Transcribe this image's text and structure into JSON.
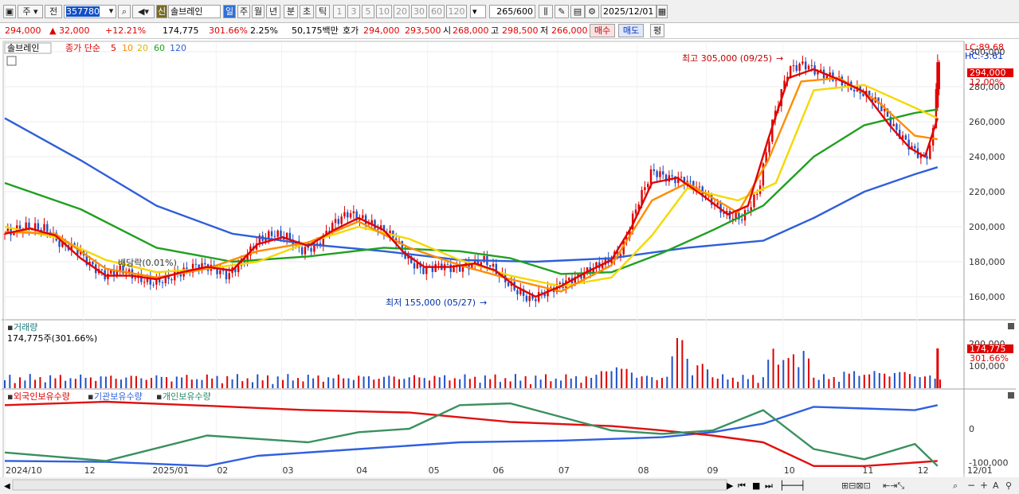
{
  "toolbar": {
    "market": "주",
    "period_ref": "전",
    "code": "357780",
    "stock_name_badge": "신",
    "stock_name": "솔브레인",
    "periods": [
      "일",
      "주",
      "월",
      "년",
      "분",
      "초",
      "틱"
    ],
    "minute_options": [
      "1",
      "3",
      "5",
      "10",
      "20",
      "30",
      "60",
      "120"
    ],
    "count": "265",
    "count_total": "/600",
    "date": "2025/12/01"
  },
  "info": {
    "price": "294,000",
    "change": "▲  32,000",
    "change_pct": "+12.21%",
    "volume": "174,775",
    "vol_ratio": "301.66%",
    "turnover": "2.25%",
    "amount": "50,175백만",
    "bid_label": "호가",
    "bid": "294,000",
    "ask": "293,500",
    "open_label": "시",
    "open": "268,000",
    "high_label": "고",
    "high": "298,500",
    "low_label": "저",
    "low": "266,000",
    "buy_button": "매수",
    "sell_button": "매도",
    "avg_button": "평"
  },
  "legend": {
    "name": "솔브레인",
    "price_label": "종가 단순",
    "ma": [
      "5",
      "10",
      "20",
      "60",
      "120"
    ]
  },
  "annotations": {
    "high": "최고 305,000 (09/25)",
    "low": "최저 155,000 (05/27)",
    "dividend": "배당락(0.01%)",
    "lc": "LC:89.68",
    "hc": "HC:-3.61",
    "price_tag": "294,000",
    "pct_tag": "12.00%",
    "vol_title": "거래량",
    "vol_value": "174,775주(301.66%)",
    "vol_tag": "174,775",
    "vol_pct_tag": "301.66%",
    "inv_titles": [
      "외국인보유수량",
      "기관보유수량",
      "개인보유수량"
    ]
  },
  "colors": {
    "up": "#e00000",
    "down": "#1f52c8",
    "ma5": "#e00000",
    "ma10": "#ff8c00",
    "ma20": "#f5d800",
    "ma60": "#20a020",
    "ma120": "#2f5fd8",
    "foreign": "#3060e0",
    "institution": "#e01010",
    "individual": "#3a9060"
  },
  "chart_data": {
    "type": "candlestick",
    "y_ticks": [
      "300,000",
      "280,000",
      "260,000",
      "240,000",
      "220,000",
      "200,000",
      "180,000",
      "160,000"
    ],
    "y_range": [
      150000,
      305000
    ],
    "vol_ticks": [
      "200,000",
      "100,000"
    ],
    "inv_ticks": [
      "0",
      "-100,000"
    ],
    "x_labels": [
      "2024/10",
      "12",
      "2025/01",
      "02",
      "03",
      "04",
      "05",
      "06",
      "07",
      "08",
      "09",
      "10",
      "11",
      "12",
      "12/01"
    ],
    "close_path": [
      [
        0,
        196000
      ],
      [
        8,
        200000
      ],
      [
        16,
        199000
      ],
      [
        22,
        190000
      ],
      [
        28,
        188000
      ],
      [
        34,
        178000
      ],
      [
        40,
        172000
      ],
      [
        46,
        176000
      ],
      [
        52,
        171000
      ],
      [
        58,
        168000
      ],
      [
        64,
        170000
      ],
      [
        70,
        174000
      ],
      [
        76,
        178000
      ],
      [
        82,
        177000
      ],
      [
        88,
        172000
      ],
      [
        94,
        180000
      ],
      [
        100,
        192000
      ],
      [
        106,
        196000
      ],
      [
        112,
        194000
      ],
      [
        118,
        186000
      ],
      [
        124,
        190000
      ],
      [
        130,
        202000
      ],
      [
        136,
        208000
      ],
      [
        142,
        204000
      ],
      [
        148,
        199000
      ],
      [
        154,
        194000
      ],
      [
        160,
        180000
      ],
      [
        166,
        175000
      ],
      [
        172,
        178000
      ],
      [
        178,
        176000
      ],
      [
        184,
        178000
      ],
      [
        190,
        181000
      ],
      [
        196,
        172000
      ],
      [
        202,
        164000
      ],
      [
        208,
        158000
      ],
      [
        214,
        163000
      ],
      [
        220,
        167000
      ],
      [
        226,
        171000
      ],
      [
        232,
        176000
      ],
      [
        238,
        180000
      ],
      [
        244,
        186000
      ],
      [
        250,
        212000
      ],
      [
        256,
        232000
      ],
      [
        262,
        228000
      ],
      [
        268,
        227000
      ],
      [
        274,
        222000
      ],
      [
        280,
        214000
      ],
      [
        286,
        206000
      ],
      [
        292,
        205000
      ],
      [
        298,
        220000
      ],
      [
        304,
        262000
      ],
      [
        310,
        290000
      ],
      [
        316,
        293000
      ],
      [
        322,
        288000
      ],
      [
        328,
        285000
      ],
      [
        334,
        280000
      ],
      [
        340,
        276000
      ],
      [
        346,
        270000
      ],
      [
        352,
        256000
      ],
      [
        358,
        246000
      ],
      [
        364,
        238000
      ],
      [
        367,
        250000
      ],
      [
        369,
        294000
      ]
    ],
    "ma5": [
      [
        0,
        196000
      ],
      [
        10,
        199000
      ],
      [
        20,
        195000
      ],
      [
        30,
        182000
      ],
      [
        40,
        172000
      ],
      [
        50,
        172000
      ],
      [
        60,
        170000
      ],
      [
        70,
        174000
      ],
      [
        80,
        177000
      ],
      [
        90,
        175000
      ],
      [
        100,
        190000
      ],
      [
        110,
        194000
      ],
      [
        120,
        189000
      ],
      [
        130,
        198000
      ],
      [
        140,
        205000
      ],
      [
        150,
        198000
      ],
      [
        158,
        185000
      ],
      [
        166,
        177000
      ],
      [
        176,
        177000
      ],
      [
        186,
        179000
      ],
      [
        194,
        175000
      ],
      [
        202,
        166000
      ],
      [
        210,
        160000
      ],
      [
        220,
        166000
      ],
      [
        230,
        174000
      ],
      [
        240,
        181000
      ],
      [
        248,
        200000
      ],
      [
        256,
        225000
      ],
      [
        266,
        228000
      ],
      [
        276,
        218000
      ],
      [
        286,
        207000
      ],
      [
        294,
        212000
      ],
      [
        302,
        250000
      ],
      [
        310,
        285000
      ],
      [
        320,
        290000
      ],
      [
        330,
        284000
      ],
      [
        340,
        277000
      ],
      [
        350,
        258000
      ],
      [
        358,
        245000
      ],
      [
        364,
        240000
      ],
      [
        369,
        262000
      ]
    ],
    "ma10": [
      [
        0,
        197000
      ],
      [
        20,
        196000
      ],
      [
        40,
        176000
      ],
      [
        60,
        171000
      ],
      [
        80,
        176000
      ],
      [
        100,
        186000
      ],
      [
        120,
        191000
      ],
      [
        140,
        203000
      ],
      [
        160,
        188000
      ],
      [
        180,
        178000
      ],
      [
        200,
        170000
      ],
      [
        220,
        163000
      ],
      [
        240,
        178000
      ],
      [
        256,
        215000
      ],
      [
        270,
        225000
      ],
      [
        290,
        208000
      ],
      [
        302,
        238000
      ],
      [
        315,
        283000
      ],
      [
        330,
        285000
      ],
      [
        345,
        272000
      ],
      [
        360,
        252000
      ],
      [
        369,
        250000
      ]
    ],
    "ma20": [
      [
        0,
        200000
      ],
      [
        20,
        194000
      ],
      [
        40,
        181000
      ],
      [
        60,
        174000
      ],
      [
        80,
        176000
      ],
      [
        100,
        180000
      ],
      [
        120,
        191000
      ],
      [
        140,
        200000
      ],
      [
        160,
        193000
      ],
      [
        180,
        181000
      ],
      [
        200,
        172000
      ],
      [
        220,
        166000
      ],
      [
        240,
        171000
      ],
      [
        256,
        195000
      ],
      [
        270,
        222000
      ],
      [
        290,
        215000
      ],
      [
        305,
        225000
      ],
      [
        320,
        278000
      ],
      [
        340,
        281000
      ],
      [
        360,
        268000
      ],
      [
        369,
        262000
      ]
    ],
    "ma60": [
      [
        0,
        225000
      ],
      [
        30,
        210000
      ],
      [
        60,
        188000
      ],
      [
        90,
        180000
      ],
      [
        120,
        183000
      ],
      [
        150,
        188000
      ],
      [
        180,
        186000
      ],
      [
        200,
        182000
      ],
      [
        220,
        173000
      ],
      [
        240,
        174000
      ],
      [
        260,
        185000
      ],
      [
        280,
        198000
      ],
      [
        300,
        212000
      ],
      [
        320,
        240000
      ],
      [
        340,
        258000
      ],
      [
        360,
        265000
      ],
      [
        369,
        267000
      ]
    ],
    "ma120": [
      [
        0,
        262000
      ],
      [
        30,
        238000
      ],
      [
        60,
        212000
      ],
      [
        90,
        196000
      ],
      [
        120,
        190000
      ],
      [
        150,
        186000
      ],
      [
        180,
        181000
      ],
      [
        210,
        180000
      ],
      [
        240,
        182000
      ],
      [
        270,
        188000
      ],
      [
        300,
        192000
      ],
      [
        320,
        205000
      ],
      [
        340,
        220000
      ],
      [
        360,
        230000
      ],
      [
        369,
        234000
      ]
    ],
    "inv_foreign": [
      [
        0,
        -95000
      ],
      [
        40,
        -98000
      ],
      [
        80,
        -110000
      ],
      [
        100,
        -80000
      ],
      [
        140,
        -60000
      ],
      [
        180,
        -40000
      ],
      [
        220,
        -35000
      ],
      [
        240,
        -30000
      ],
      [
        260,
        -25000
      ],
      [
        280,
        -10000
      ],
      [
        300,
        15000
      ],
      [
        320,
        65000
      ],
      [
        340,
        60000
      ],
      [
        360,
        55000
      ],
      [
        369,
        70000
      ]
    ],
    "inv_institution": [
      [
        0,
        70000
      ],
      [
        40,
        80000
      ],
      [
        80,
        68000
      ],
      [
        120,
        55000
      ],
      [
        160,
        48000
      ],
      [
        200,
        20000
      ],
      [
        240,
        8000
      ],
      [
        260,
        -5000
      ],
      [
        280,
        -20000
      ],
      [
        300,
        -40000
      ],
      [
        320,
        -110000
      ],
      [
        340,
        -110000
      ],
      [
        360,
        -100000
      ],
      [
        369,
        -95000
      ]
    ],
    "inv_individual": [
      [
        0,
        -70000
      ],
      [
        40,
        -95000
      ],
      [
        80,
        -20000
      ],
      [
        120,
        -40000
      ],
      [
        140,
        -10000
      ],
      [
        160,
        0
      ],
      [
        180,
        70000
      ],
      [
        200,
        75000
      ],
      [
        220,
        35000
      ],
      [
        240,
        -5000
      ],
      [
        260,
        -15000
      ],
      [
        280,
        -5000
      ],
      [
        300,
        55000
      ],
      [
        320,
        -60000
      ],
      [
        340,
        -90000
      ],
      [
        360,
        -45000
      ],
      [
        369,
        -110000
      ]
    ]
  }
}
